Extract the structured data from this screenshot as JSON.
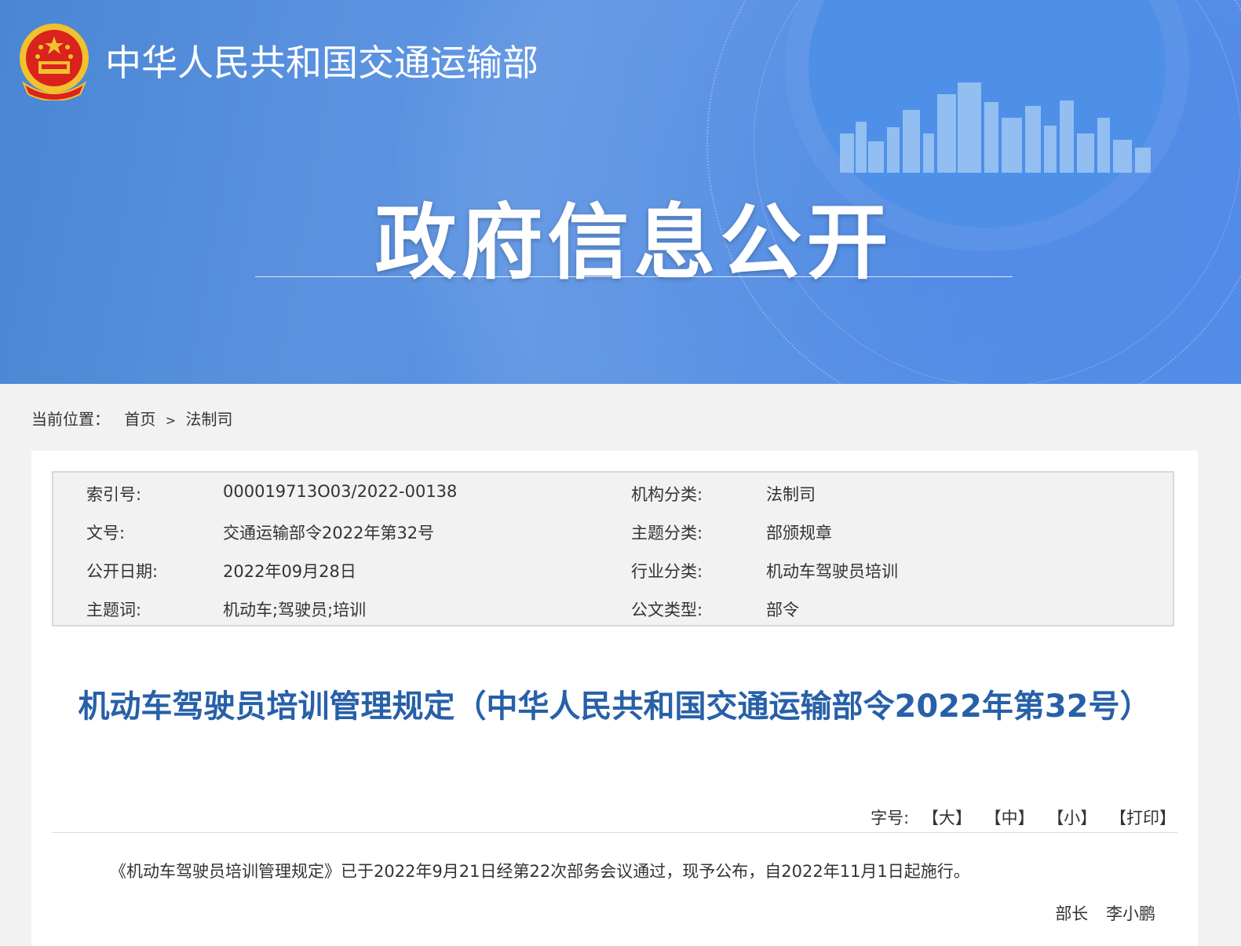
{
  "header": {
    "org_name": "中华人民共和国交通运输部",
    "banner_title": "政府信息公开"
  },
  "breadcrumb": {
    "label": "当前位置：",
    "items": [
      "首页",
      "法制司"
    ],
    "separator": ">"
  },
  "meta": {
    "rows": [
      {
        "k1": "索引号:",
        "v1": "000019713O03/2022-00138",
        "k2": "机构分类:",
        "v2": "法制司"
      },
      {
        "k1": "文号:",
        "v1": "交通运输部令2022年第32号",
        "k2": "主题分类:",
        "v2": "部颁规章"
      },
      {
        "k1": "公开日期:",
        "v1": "2022年09月28日",
        "k2": "行业分类:",
        "v2": "机动车驾驶员培训"
      },
      {
        "k1": "主题词:",
        "v1": "机动车;驾驶员;培训",
        "k2": "公文类型:",
        "v2": "部令"
      }
    ]
  },
  "document": {
    "title": "机动车驾驶员培训管理规定（中华人民共和国交通运输部令2022年第32号）",
    "font_size_label": "字号:",
    "font_large": "【大】",
    "font_medium": "【中】",
    "font_small": "【小】",
    "print": "【打印】",
    "body": "《机动车驾驶员培训管理规定》已于2022年9月21日经第22次部务会议通过，现予公布，自2022年11月1日起施行。",
    "signer_title": "部长",
    "signer_name": "李小鹏"
  },
  "colors": {
    "banner_blue": "#4a86d3",
    "title_blue": "#2760a8",
    "emblem_red": "#d9231c",
    "emblem_gold": "#f2c12e"
  }
}
